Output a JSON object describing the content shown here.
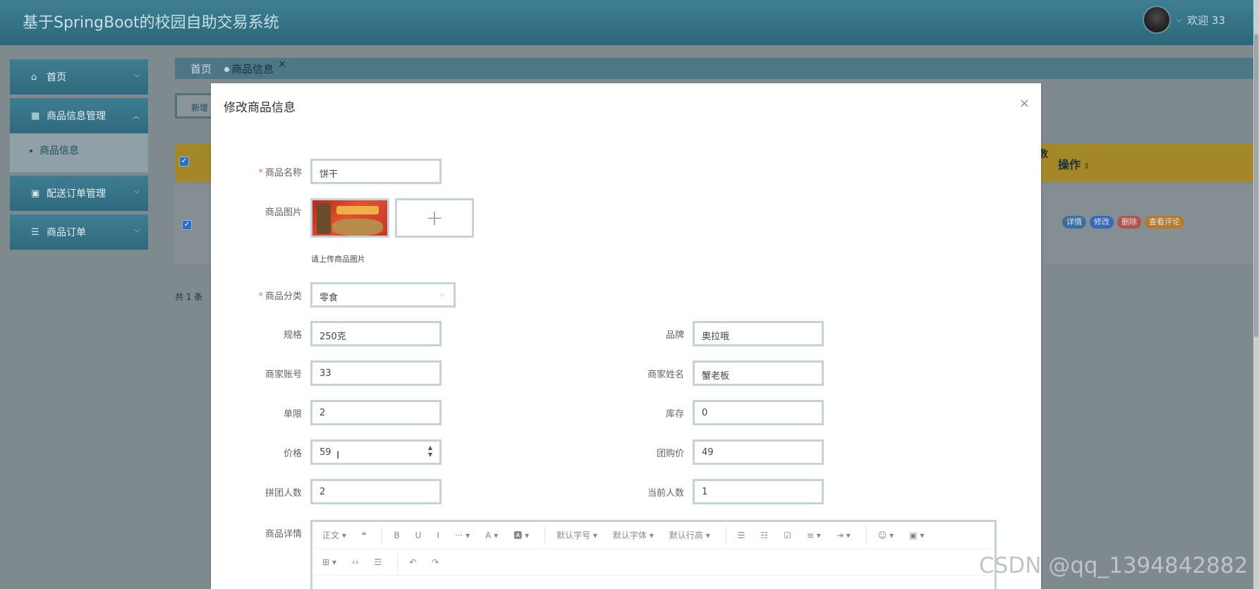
{
  "header": {
    "title": "基于SpringBoot的校园自助交易系统",
    "welcome": "欢迎 33"
  },
  "sidebar": {
    "items": [
      {
        "label": "首页",
        "icon": "home-icon"
      },
      {
        "label": "商品信息管理",
        "icon": "table-icon"
      },
      {
        "label": "配送订单管理",
        "icon": "briefcase-icon"
      },
      {
        "label": "商品订单",
        "icon": "server-icon"
      }
    ],
    "sub_item": "商品信息"
  },
  "tabs": {
    "home": "首页",
    "active": "商品信息",
    "close": "×"
  },
  "list": {
    "add_label": "新增",
    "op_header": "操作",
    "op_sort": "⇕",
    "op_prev_cut": "数",
    "row_buttons": [
      {
        "label": "详情",
        "color": "#3d6e9e"
      },
      {
        "label": "修改",
        "color": "#3a68b8"
      },
      {
        "label": "删除",
        "color": "#b35247"
      },
      {
        "label": "查看评论",
        "color": "#b67a2d"
      }
    ],
    "total": "共 1 条"
  },
  "dialog": {
    "title": "修改商品信息",
    "close": "×",
    "fields": {
      "name": {
        "label": "商品名称",
        "value": "饼干",
        "required": true
      },
      "image": {
        "label": "商品图片",
        "upload": "+",
        "hint": "请上传商品图片"
      },
      "category": {
        "label": "商品分类",
        "value": "零食",
        "required": true
      },
      "spec": {
        "label": "规格",
        "value": "250克"
      },
      "brand": {
        "label": "品牌",
        "value": "奥拉哦"
      },
      "merchant_account": {
        "label": "商家账号",
        "value": "33"
      },
      "merchant_name": {
        "label": "商家姓名",
        "value": "蟹老板"
      },
      "limit": {
        "label": "单限",
        "value": "2"
      },
      "stock": {
        "label": "库存",
        "value": "0"
      },
      "price": {
        "label": "价格",
        "value": "59"
      },
      "group_price": {
        "label": "团购价",
        "value": "49"
      },
      "group_size": {
        "label": "拼团人数",
        "value": "2"
      },
      "current_count": {
        "label": "当前人数",
        "value": "1"
      },
      "detail": {
        "label": "商品详情"
      }
    },
    "editor": {
      "row1": [
        "正文 ▾",
        "❝",
        "B",
        "U",
        "I",
        "··· ▾",
        "A ▾",
        "🅰 ▾",
        "默认字号 ▾",
        "默认字体 ▾",
        "默认行高 ▾",
        "☰",
        "☷",
        "☑",
        "≡ ▾",
        "⇥ ▾",
        "☺ ▾",
        "▣ ▾"
      ],
      "row2": [
        "⊞ ▾",
        "‹›",
        "☲",
        "↶",
        "↷"
      ]
    }
  },
  "watermark": "CSDN @qq_1394842882"
}
